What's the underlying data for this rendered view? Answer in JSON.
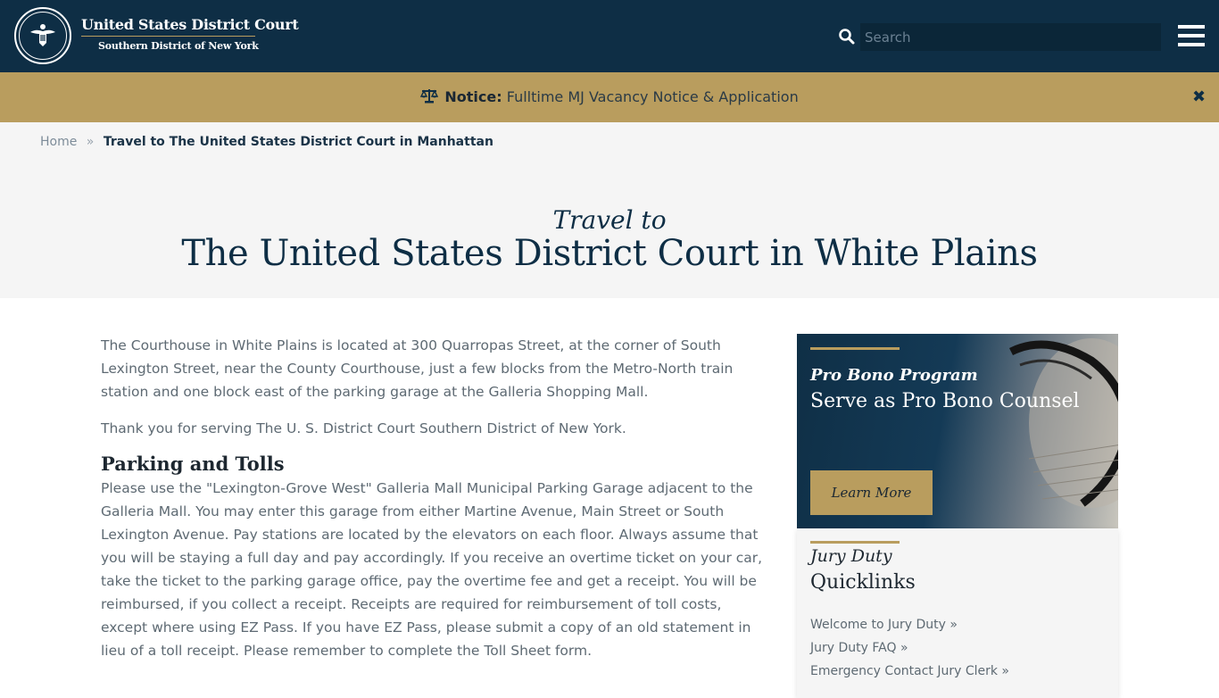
{
  "header": {
    "court_name": "United States District Court",
    "district_name": "Southern District of New York",
    "search_placeholder": "Search",
    "search_icon": "search-icon",
    "menu_icon": "hamburger-menu-icon"
  },
  "notice": {
    "icon": "scales-icon",
    "label": "Notice:",
    "link_text": "Fulltime MJ Vacancy Notice & Application",
    "close_glyph": "✖"
  },
  "breadcrumb": {
    "home": "Home",
    "separator": "»",
    "current": "Travel to The United States District Court in Manhattan"
  },
  "hero": {
    "kicker": "Travel to",
    "title": "The United States District Court in White Plains"
  },
  "main": {
    "intro": "The Courthouse in White Plains is located at 300 Quarropas Street, at the corner of South Lexington Street, near the County Courthouse, just a few blocks from the Metro-North train station and one block east of the parking garage at the Galleria Shopping Mall.",
    "thanks": "Thank you for serving The U. S. District Court Southern District of New York.",
    "parking_heading": "Parking and Tolls",
    "parking_body": "Please use the \"Lexington-Grove West\" Galleria Mall Municipal Parking Garage adjacent to the Galleria Mall. You may enter this garage from either Martine Avenue, Main Street or South Lexington Avenue.  Pay stations are located by the elevators on each floor.  Always assume that you will be staying a full day and pay accordingly. If you receive an overtime ticket on your car, take the ticket to the parking garage office, pay the overtime fee and get a receipt.   You will be reimbursed, if you collect a receipt.  Receipts are required for reimbursement of toll costs, except where using EZ Pass.  If you have EZ Pass, please submit a copy of an old statement in lieu of a toll receipt.  Please remember to complete the Toll Sheet form."
  },
  "sidebar": {
    "promo": {
      "kicker": "Pro Bono Program",
      "title": "Serve as Pro Bono Counsel",
      "button": "Learn More"
    },
    "quicklinks": {
      "kicker": "Jury Duty",
      "title": "Quicklinks",
      "links": [
        "Welcome to Jury Duty »",
        "Jury Duty FAQ »",
        "Emergency Contact Jury Clerk »"
      ]
    }
  },
  "colors": {
    "navy": "#0e2e45",
    "gold": "#b99d5e",
    "light_gray": "#f5f5f5"
  }
}
